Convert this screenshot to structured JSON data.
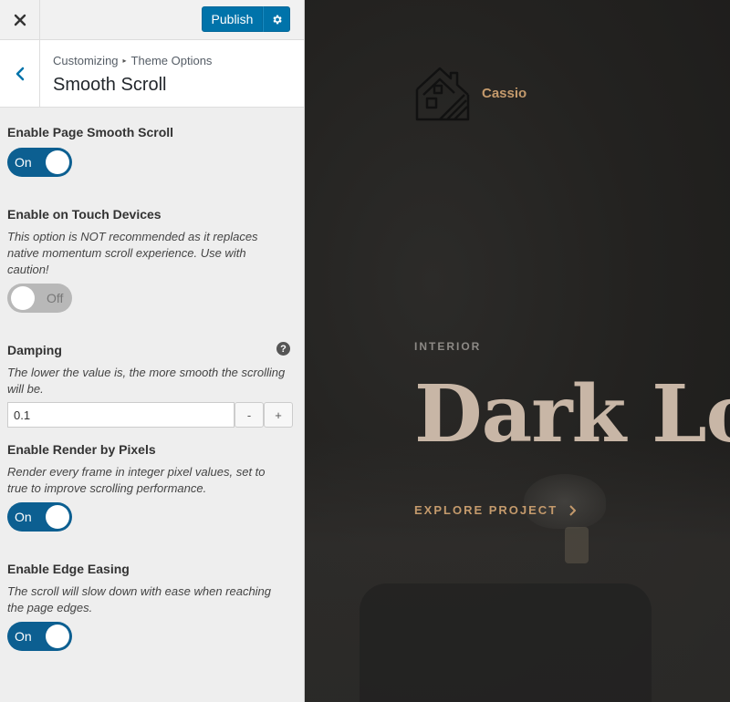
{
  "topbar": {
    "publish_label": "Publish"
  },
  "section": {
    "breadcrumb_parent": "Customizing",
    "breadcrumb_sep": "▸",
    "breadcrumb_current": "Theme Options",
    "title": "Smooth Scroll"
  },
  "controls": {
    "page_smooth": {
      "title": "Enable Page Smooth Scroll",
      "state": "On"
    },
    "touch": {
      "title": "Enable on Touch Devices",
      "description": "This option is NOT recommended as it replaces native momentum scroll experience. Use with caution!",
      "state": "Off"
    },
    "damping": {
      "title": "Damping",
      "description": "The lower the value is, the more smooth the scrolling will be.",
      "value": "0.1",
      "minus": "-",
      "plus": "+",
      "help": "?"
    },
    "render_pixels": {
      "title": "Enable Render by Pixels",
      "description": "Render every frame in integer pixel values, set to true to improve scrolling performance.",
      "state": "On"
    },
    "edge_easing": {
      "title": "Enable Edge Easing",
      "description": "The scroll will slow down with ease when reaching the page edges.",
      "state": "On"
    }
  },
  "preview": {
    "site_name": "Cassio",
    "hero_category": "INTERIOR",
    "hero_title": "Dark Loft",
    "explore_label": "EXPLORE PROJECT"
  },
  "colors": {
    "primary_blue": "#0073aa",
    "toggle_on": "#0c5f91",
    "toggle_off": "#b8b8b8",
    "accent_gold": "#c49a6c",
    "hero_title": "#c8b6a6"
  },
  "icons": [
    "close-icon",
    "gear-icon",
    "chevron-left-icon",
    "help-icon",
    "house-logo-icon",
    "chevron-right-icon"
  ]
}
